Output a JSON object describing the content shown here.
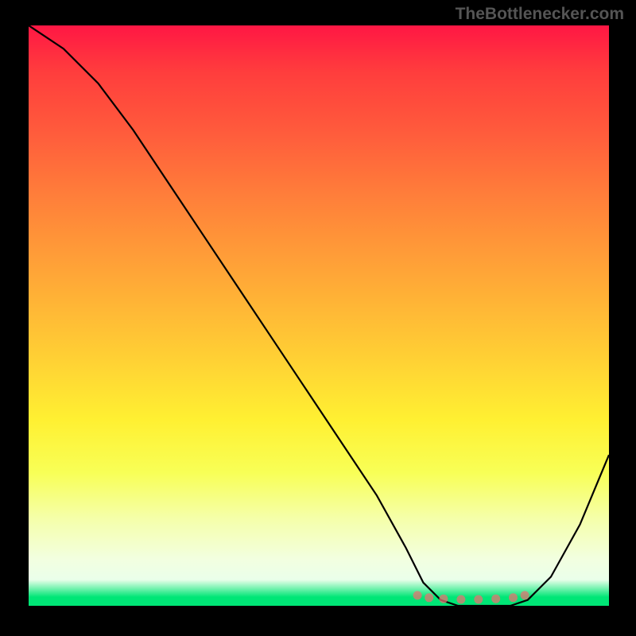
{
  "watermark": "TheBottlenecker.com",
  "chart_data": {
    "type": "line",
    "title": "",
    "xlabel": "",
    "ylabel": "",
    "xlim": [
      0,
      100
    ],
    "ylim": [
      0,
      100
    ],
    "x": [
      0,
      6,
      12,
      18,
      24,
      30,
      36,
      42,
      48,
      54,
      60,
      65,
      68,
      71,
      74,
      77,
      80,
      83,
      86,
      90,
      95,
      100
    ],
    "values": [
      100,
      96,
      90,
      82,
      73,
      64,
      55,
      46,
      37,
      28,
      19,
      10,
      4,
      1,
      0,
      0,
      0,
      0,
      1,
      5,
      14,
      26
    ],
    "markers": {
      "x": [
        67,
        69,
        71.5,
        74.5,
        77.5,
        80.5,
        83.5,
        85.5
      ],
      "y": [
        1.8,
        1.4,
        1.2,
        1.1,
        1.1,
        1.2,
        1.4,
        1.8
      ]
    },
    "gradient_stops": [
      {
        "pos": 0.0,
        "color": "#ff1744"
      },
      {
        "pos": 0.45,
        "color": "#ffc107"
      },
      {
        "pos": 0.78,
        "color": "#fff59d"
      },
      {
        "pos": 0.96,
        "color": "#eaffea"
      },
      {
        "pos": 1.0,
        "color": "#00e676"
      }
    ]
  }
}
